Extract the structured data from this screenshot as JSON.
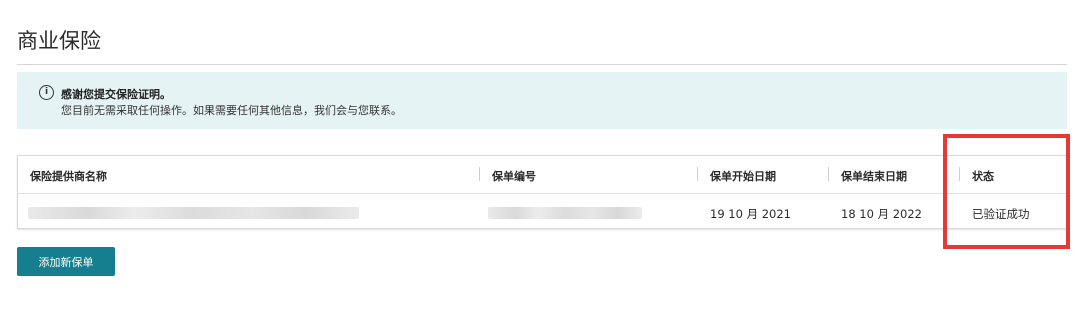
{
  "page": {
    "title": "商业保险"
  },
  "notice": {
    "icon": "info-icon",
    "icon_glyph": "i",
    "title": "感谢您提交保险证明。",
    "body": "您目前无需采取任何操作。如果需要任何其他信息，我们会与您联系。"
  },
  "table": {
    "headers": {
      "provider": "保险提供商名称",
      "policy_number": "保单编号",
      "start_date": "保单开始日期",
      "end_date": "保单结束日期",
      "status": "状态"
    },
    "rows": [
      {
        "provider": "",
        "policy_number": "",
        "start_date": "19 10 月 2021",
        "end_date": "18 10 月 2022",
        "status": "已验证成功"
      }
    ]
  },
  "actions": {
    "add_policy_label": "添加新保单"
  },
  "colors": {
    "accent": "#157f8f",
    "notice_bg": "#e6f3f4",
    "highlight": "#e53935"
  }
}
